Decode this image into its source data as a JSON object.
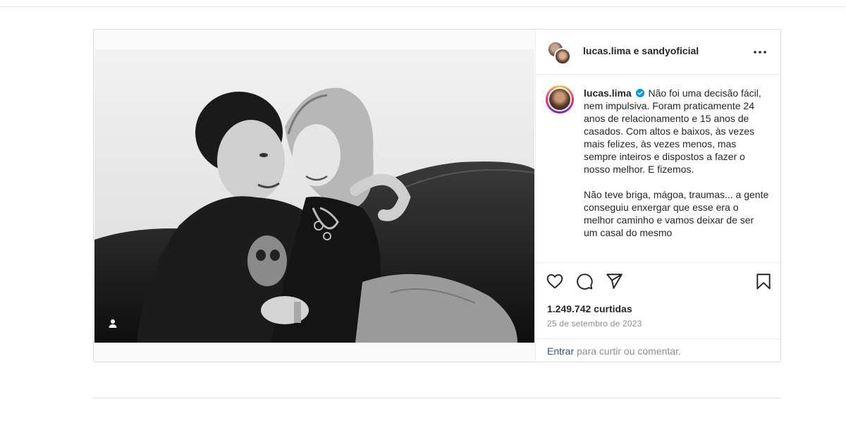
{
  "post": {
    "header": {
      "user1": "lucas.lima",
      "connector": " e ",
      "user2": "sandyoficial",
      "more_icon": "more-horizontal-icon"
    },
    "caption": {
      "username": "lucas.lima",
      "verified_icon": "verified-badge-icon",
      "paragraph1": "Não foi uma decisão fácil, nem impulsiva. Foram praticamente 24 anos de relacionamento e 15 anos de casados. Com altos e baixos, às vezes mais felizes, às vezes menos, mas sempre inteiros e dispostos a fazer o nosso melhor. E fizemos.",
      "paragraph2": "Não teve briga, mágoa, traumas... a gente conseguiu enxergar que esse era o melhor caminho e vamos deixar de ser um casal do mesmo"
    },
    "actions": {
      "like_icon": "heart-icon",
      "comment_icon": "comment-icon",
      "share_icon": "send-icon",
      "save_icon": "bookmark-icon"
    },
    "likes": "1.249.742 curtidas",
    "date": "25 de setembro de 2023",
    "login": {
      "link": "Entrar",
      "rest": " para curtir ou comentar."
    },
    "media": {
      "tag_icon": "user-tag-icon"
    }
  },
  "colors": {
    "link": "#385185",
    "secondary_text": "#8e8e8e",
    "verified": "#0095f6"
  }
}
